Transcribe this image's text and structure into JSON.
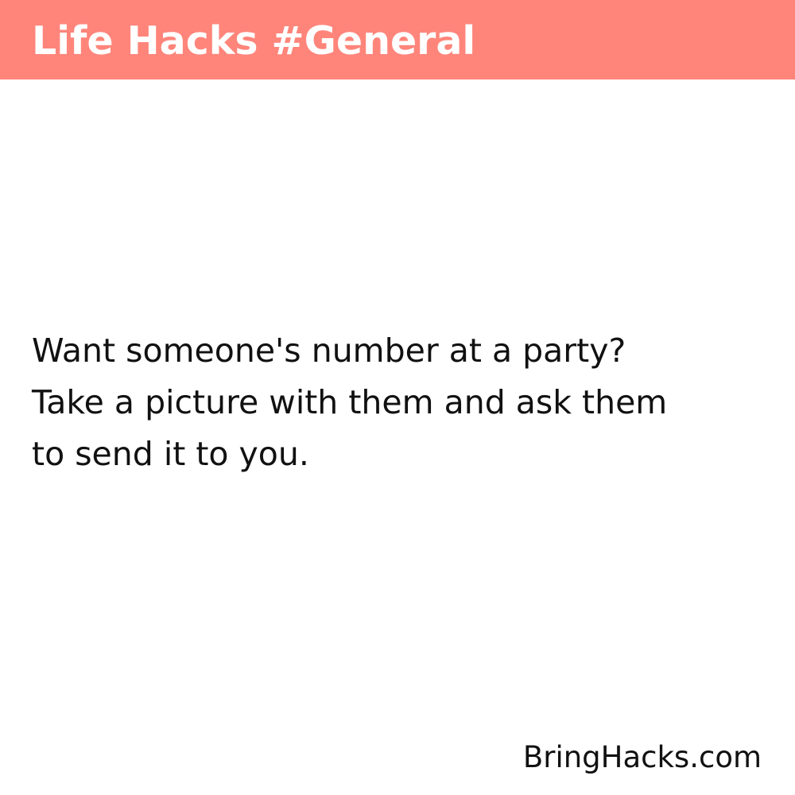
{
  "header": {
    "title": "Life Hacks #General",
    "background_color": "#ff857b",
    "text_color": "#ffffff"
  },
  "hack": {
    "lines": [
      "Want someone's number at a party?",
      "Take a picture with them and ask them",
      "to send it to you."
    ]
  },
  "footer": {
    "site": "BringHacks.com"
  }
}
